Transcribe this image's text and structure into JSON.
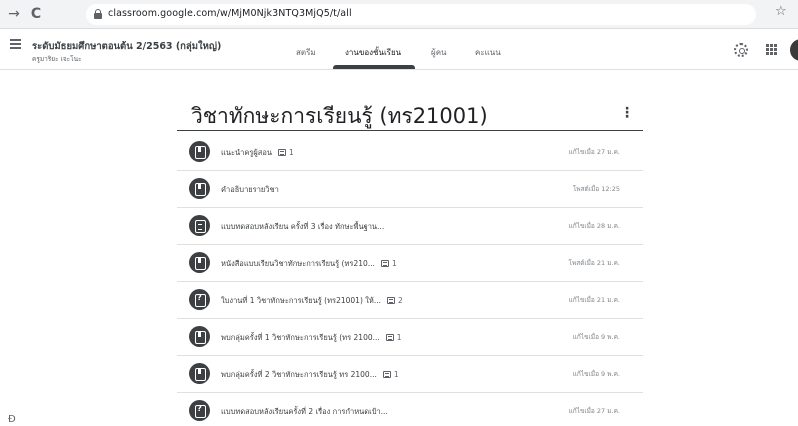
{
  "browser": {
    "back": "→",
    "reload": "C",
    "url": "classroom.google.com/w/MjM0Njk3NTQ3MjQ5/t/all",
    "bookmark": "☆"
  },
  "header": {
    "class_title": "ระดับมัธยมศึกษาตอนต้น 2/2563 (กลุ่มใหญ่)",
    "class_subtitle": "ครูมาริยะ เจะโนะ",
    "tabs": [
      {
        "label": "สตรีม",
        "active": false
      },
      {
        "label": "งานของชั้นเรียน",
        "active": true
      },
      {
        "label": "ผู้คน",
        "active": false
      },
      {
        "label": "คะแนน",
        "active": false
      }
    ]
  },
  "topic": {
    "title": "วิชาทักษะการเรียนรู้ (ทร21001)",
    "more": "⋮"
  },
  "items": [
    {
      "title": "แนะนำครูผู้สอน",
      "attachments": "1",
      "date": "แก้ไขเมื่อ 27 ม.ค.",
      "icon": "material-icon"
    },
    {
      "title": "คำอธิบายรายวิชา",
      "attachments": "",
      "date": "โพสต์เมื่อ 12:25",
      "icon": "material-icon"
    },
    {
      "title": "แบบทดสอบหลังเรียน ครั้งที่ 3 เรื่อง ทักษะพื้นฐาน...",
      "attachments": "",
      "date": "แก้ไขเมื่อ 28 ม.ค.",
      "icon": "assignment-icon"
    },
    {
      "title": "หนังสือแบบเรียนวิชาทักษะการเรียนรู้ (ทร210...",
      "attachments": "1",
      "date": "โพสต์เมื่อ 21 ม.ค.",
      "icon": "material-icon"
    },
    {
      "title": "ใบงานที่ 1 วิชาทักษะการเรียนรู้ (ทร21001) ให้...",
      "attachments": "2",
      "date": "แก้ไขเมื่อ 21 ม.ค.",
      "icon": "question-icon"
    },
    {
      "title": "พบกลุ่มครั้งที่ 1 วิชาทักษะการเรียนรู้ (ทร 2100...",
      "attachments": "1",
      "date": "แก้ไขเมื่อ 9 พ.ค.",
      "icon": "material-icon"
    },
    {
      "title": "พบกลุ่มครั้งที่ 2 วิชาทักษะการเรียนรู้ ทร 2100...",
      "attachments": "1",
      "date": "แก้ไขเมื่อ 9 พ.ค.",
      "icon": "material-icon"
    },
    {
      "title": "แบบทดสอบหลังเรียนครั้งที่ 2 เรื่อง การกำหนดเป้า...",
      "attachments": "",
      "date": "แก้ไขเมื่อ 27 ม.ค.",
      "icon": "question-icon"
    }
  ],
  "side_icon": "Ð"
}
